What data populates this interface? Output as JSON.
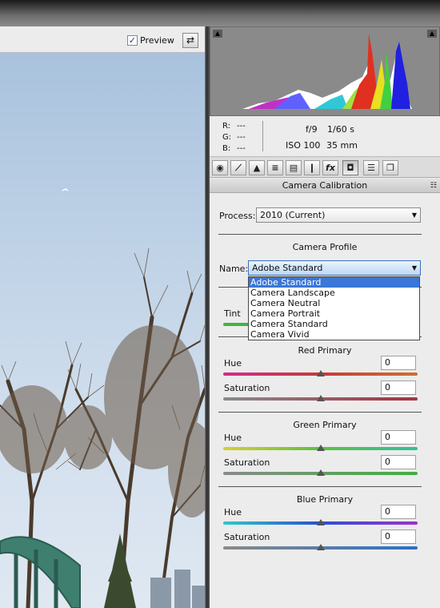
{
  "preview": {
    "label": "Preview",
    "checked": "✓",
    "toggle_icon": "⇄"
  },
  "info": {
    "r_label": "R:",
    "g_label": "G:",
    "b_label": "B:",
    "r_val": "---",
    "g_val": "---",
    "b_val": "---",
    "aperture": "f/9",
    "shutter": "1/60 s",
    "iso": "ISO 100",
    "focal": "35 mm"
  },
  "tabs": [
    {
      "icon": "basic-icon",
      "glyph": "◉"
    },
    {
      "icon": "tone-curve-icon",
      "glyph": "⟋"
    },
    {
      "icon": "detail-icon",
      "glyph": "▲"
    },
    {
      "icon": "hsl-icon",
      "glyph": "≡"
    },
    {
      "icon": "split-toning-icon",
      "glyph": "▤"
    },
    {
      "icon": "lens-corrections-icon",
      "glyph": "❙"
    },
    {
      "icon": "effects-icon",
      "glyph": "fx"
    },
    {
      "icon": "camera-calibration-icon",
      "glyph": "◘"
    },
    {
      "icon": "presets-icon",
      "glyph": "☰"
    },
    {
      "icon": "snapshots-icon",
      "glyph": "❐"
    }
  ],
  "panel": {
    "title": "Camera Calibration",
    "menu_icon": "☷"
  },
  "process": {
    "label": "Process:",
    "value": "2010 (Current)"
  },
  "camera_profile": {
    "title": "Camera Profile",
    "name_label": "Name:",
    "value": "Adobe Standard",
    "options": [
      "Adobe Standard",
      "Camera Landscape",
      "Camera Neutral",
      "Camera Portrait",
      "Camera Standard",
      "Camera Vivid"
    ]
  },
  "shadows": {
    "tint_label": "Tint"
  },
  "red_primary": {
    "title": "Red Primary",
    "hue_label": "Hue",
    "hue": "0",
    "sat_label": "Saturation",
    "sat": "0"
  },
  "green_primary": {
    "title": "Green Primary",
    "hue_label": "Hue",
    "hue": "0",
    "sat_label": "Saturation",
    "sat": "0"
  },
  "blue_primary": {
    "title": "Blue Primary",
    "hue_label": "Hue",
    "hue": "0",
    "sat_label": "Saturation",
    "sat": "0"
  },
  "colors": {
    "selection": "#3a77d8",
    "panel_bg": "#ececec"
  }
}
